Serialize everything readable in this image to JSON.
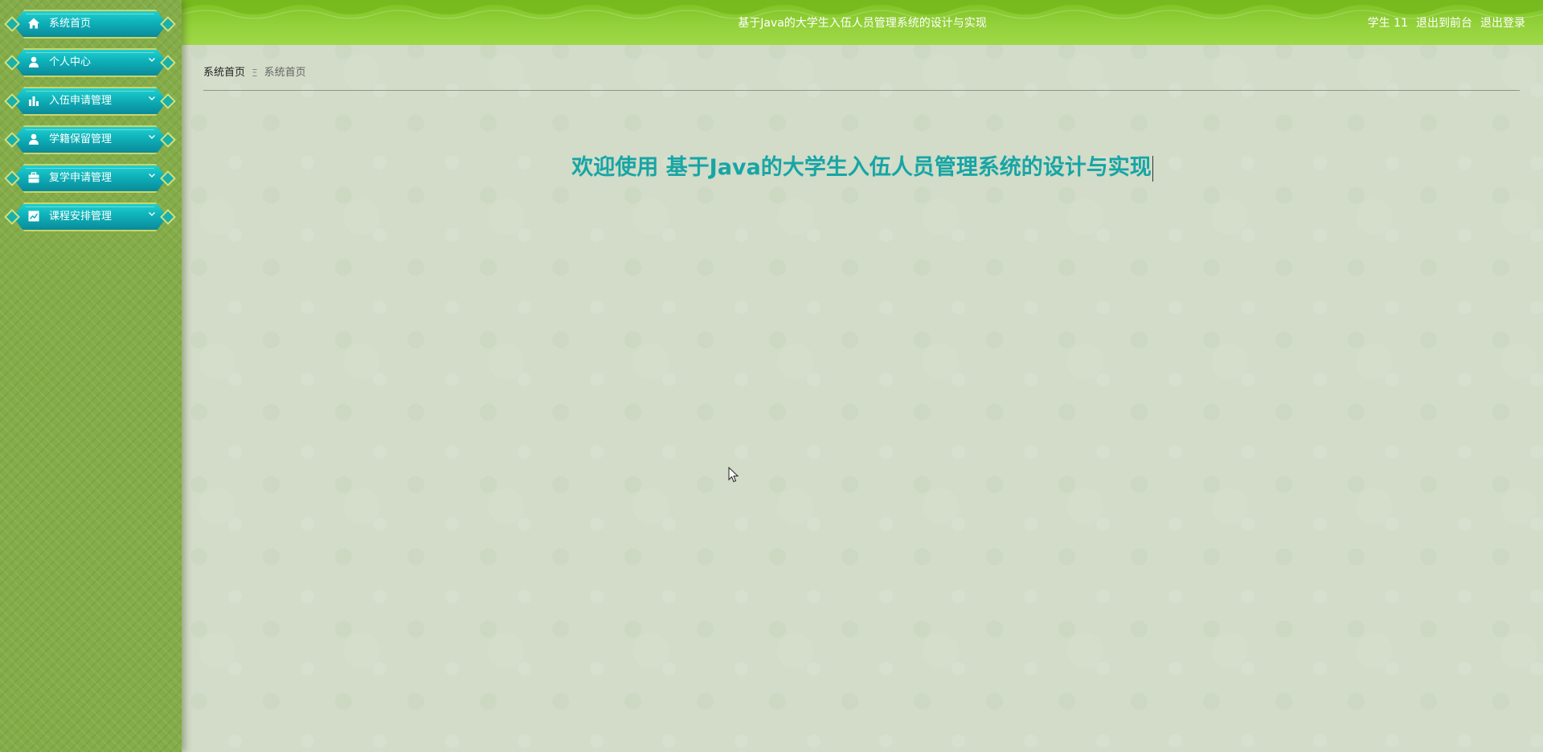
{
  "header": {
    "title": "基于Java的大学生入伍人员管理系统的设计与实现",
    "user": "学生 11",
    "to_frontend": "退出到前台",
    "logout": "退出登录"
  },
  "sidebar": {
    "items": [
      {
        "label": "系统首页",
        "icon": "home-icon"
      },
      {
        "label": "个人中心",
        "icon": "user-icon"
      },
      {
        "label": "入伍申请管理",
        "icon": "bar-chart-icon"
      },
      {
        "label": "学籍保留管理",
        "icon": "user-icon"
      },
      {
        "label": "复学申请管理",
        "icon": "briefcase-icon"
      },
      {
        "label": "课程安排管理",
        "icon": "line-chart-icon"
      }
    ]
  },
  "breadcrumb": {
    "home": "系统首页",
    "separator": "Ξ",
    "current": "系统首页"
  },
  "main": {
    "welcome": "欢迎使用 基于Java的大学生入伍人员管理系统的设计与实现"
  },
  "colors": {
    "header_green": "#95d23c",
    "sidebar_green": "#84ac48",
    "menu_teal": "#0eb0b8",
    "welcome_teal": "#17a5a5",
    "background": "#d2dcc8"
  }
}
